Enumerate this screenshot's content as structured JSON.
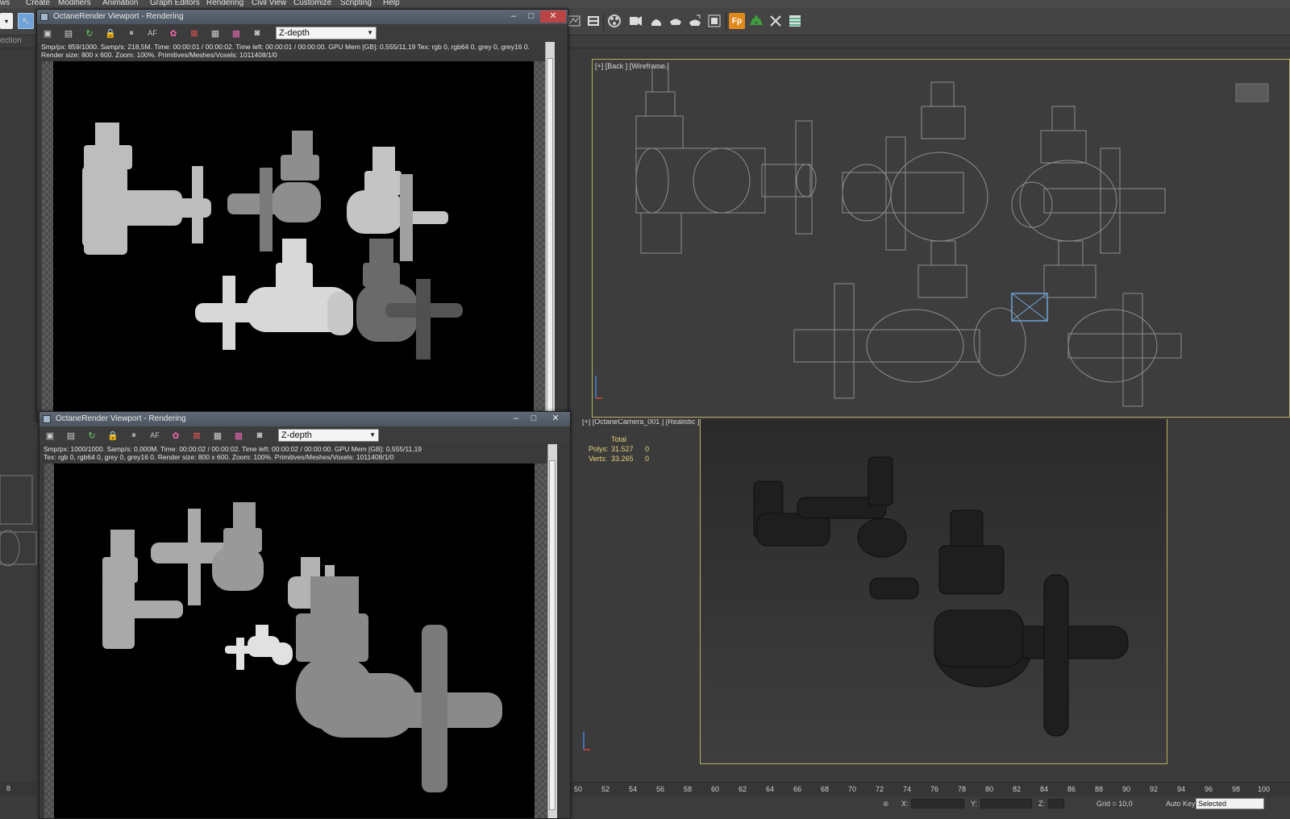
{
  "menu": [
    "ws",
    "Create",
    "Modifiers",
    "Animation",
    "Graph Editors",
    "Rendering",
    "Civil View",
    "Customize",
    "Scripting",
    "Help"
  ],
  "ribbon": {
    "label": "ection"
  },
  "octane_top": {
    "title": "OctaneRender Viewport - Rendering",
    "mode": "Z-depth",
    "status_line1": "Smp/px: 859/1000.   Samp/s: 218,5M.   Time: 00:00:01 / 00:00:02.   Time left: 00:00:01 / 00:00:00.   GPU Mem [GB]: 0,555/11,19   Tex: rgb 0, rgb64 0, grey 0, grey16 0.",
    "status_line2": "Render size: 800 x 600.   Zoom: 100%.   Primitives/Meshes/Voxels: 1011408/1/0"
  },
  "octane_bottom": {
    "title": "OctaneRender Viewport - Rendering",
    "mode": "Z-depth",
    "status_line1": "Smp/px: 1000/1000.   Samp/s: 0,000M.   Time: 00:00:02 / 00:00:02.   Time left: 00:00:02 / 00:00:00.   GPU Mem [GB]: 0,555/11,19",
    "status_line2": "Tex: rgb 0, rgb64 0, grey 0, grey16 0.   Render size: 800 x 600.   Zoom: 100%.   Primitives/Meshes/Voxels: 1011408/1/0"
  },
  "viewport_top": {
    "label": "[+] [Back ] [Wireframe ]"
  },
  "viewport_bottom": {
    "label": "[+] [OctaneCamera_001 ] [Realistic ]",
    "stats": {
      "header": "Total",
      "polys_label": "Polys:",
      "polys_value": "31.527",
      "polys_extra": "0",
      "verts_label": "Verts:",
      "verts_value": "33.265",
      "verts_extra": "0"
    }
  },
  "timeline": {
    "ticks": [
      "50",
      "52",
      "54",
      "56",
      "58",
      "60",
      "62",
      "64",
      "66",
      "68",
      "70",
      "72",
      "74",
      "76",
      "78",
      "80",
      "82",
      "84",
      "86",
      "88",
      "90",
      "92",
      "94",
      "96",
      "98",
      "100"
    ],
    "left_tick": "8"
  },
  "statusbar": {
    "x_label": "X:",
    "y_label": "Y:",
    "z_label": "Z:",
    "grid": "Grid = 10,0",
    "autokey": "Auto Key",
    "selected": "Selected"
  },
  "colors": {
    "viewport_border": "#b7b060",
    "stats": "#e8d27a",
    "wire": "#8a8a8a"
  }
}
